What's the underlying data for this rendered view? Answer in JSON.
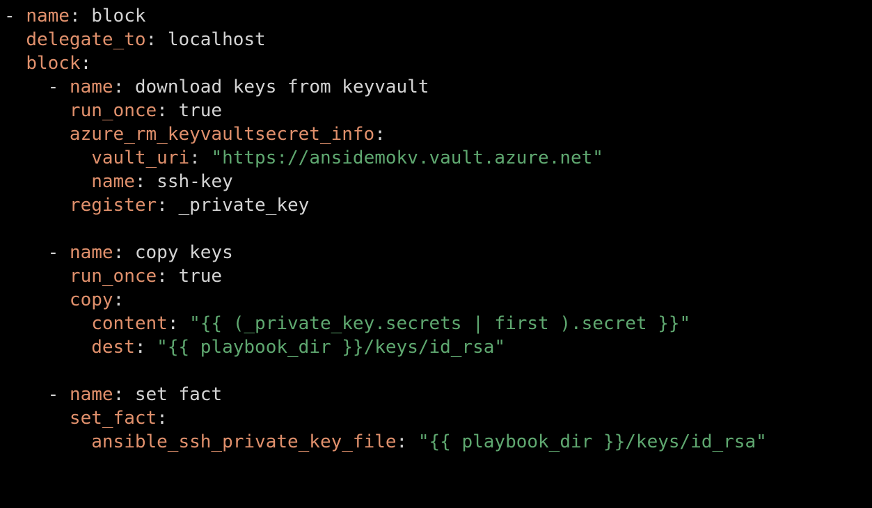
{
  "colors": {
    "background": "#000000",
    "key": "#e0906c",
    "plain": "#d4d4d4",
    "string": "#5fa870"
  },
  "lines": [
    {
      "indent": "",
      "dash": "- ",
      "key": "name",
      "sep": ": ",
      "value": "block",
      "vtype": "plain"
    },
    {
      "indent": "  ",
      "dash": "",
      "key": "delegate_to",
      "sep": ": ",
      "value": "localhost",
      "vtype": "plain"
    },
    {
      "indent": "  ",
      "dash": "",
      "key": "block",
      "sep": ":",
      "value": "",
      "vtype": "plain"
    },
    {
      "indent": "    ",
      "dash": "- ",
      "key": "name",
      "sep": ": ",
      "value": "download keys from keyvault",
      "vtype": "plain"
    },
    {
      "indent": "      ",
      "dash": "",
      "key": "run_once",
      "sep": ": ",
      "value": "true",
      "vtype": "plain"
    },
    {
      "indent": "      ",
      "dash": "",
      "key": "azure_rm_keyvaultsecret_info",
      "sep": ":",
      "value": "",
      "vtype": "plain"
    },
    {
      "indent": "        ",
      "dash": "",
      "key": "vault_uri",
      "sep": ": ",
      "value": "\"https://ansidemokv.vault.azure.net\"",
      "vtype": "string"
    },
    {
      "indent": "        ",
      "dash": "",
      "key": "name",
      "sep": ": ",
      "value": "ssh-key",
      "vtype": "plain"
    },
    {
      "indent": "      ",
      "dash": "",
      "key": "register",
      "sep": ": ",
      "value": "_private_key",
      "vtype": "plain"
    },
    {
      "indent": "",
      "dash": "",
      "key": "",
      "sep": "",
      "value": "",
      "vtype": "plain"
    },
    {
      "indent": "    ",
      "dash": "- ",
      "key": "name",
      "sep": ": ",
      "value": "copy keys",
      "vtype": "plain"
    },
    {
      "indent": "      ",
      "dash": "",
      "key": "run_once",
      "sep": ": ",
      "value": "true",
      "vtype": "plain"
    },
    {
      "indent": "      ",
      "dash": "",
      "key": "copy",
      "sep": ":",
      "value": "",
      "vtype": "plain"
    },
    {
      "indent": "        ",
      "dash": "",
      "key": "content",
      "sep": ": ",
      "value": "\"{{ (_private_key.secrets | first ).secret }}\"",
      "vtype": "string"
    },
    {
      "indent": "        ",
      "dash": "",
      "key": "dest",
      "sep": ": ",
      "value": "\"{{ playbook_dir }}/keys/id_rsa\"",
      "vtype": "string"
    },
    {
      "indent": "",
      "dash": "",
      "key": "",
      "sep": "",
      "value": "",
      "vtype": "plain"
    },
    {
      "indent": "    ",
      "dash": "- ",
      "key": "name",
      "sep": ": ",
      "value": "set fact",
      "vtype": "plain"
    },
    {
      "indent": "      ",
      "dash": "",
      "key": "set_fact",
      "sep": ":",
      "value": "",
      "vtype": "plain"
    },
    {
      "indent": "        ",
      "dash": "",
      "key": "ansible_ssh_private_key_file",
      "sep": ": ",
      "value": "\"{{ playbook_dir }}/keys/id_rsa\"",
      "vtype": "string"
    }
  ]
}
